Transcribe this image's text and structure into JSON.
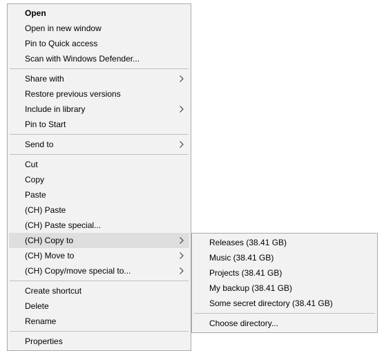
{
  "mainMenu": {
    "open": "Open",
    "openNew": "Open in new window",
    "pinQuick": "Pin to Quick access",
    "scanDefender": "Scan with Windows Defender...",
    "shareWith": "Share with",
    "restorePrev": "Restore previous versions",
    "includeLib": "Include in library",
    "pinStart": "Pin to Start",
    "sendTo": "Send to",
    "cut": "Cut",
    "copy": "Copy",
    "paste": "Paste",
    "chPaste": "(CH) Paste",
    "chPasteSpecial": "(CH) Paste special...",
    "chCopyTo": "(CH) Copy to",
    "chMoveTo": "(CH) Move to",
    "chCopyMoveSpecial": "(CH) Copy/move special to...",
    "createShortcut": "Create shortcut",
    "delete": "Delete",
    "rename": "Rename",
    "properties": "Properties"
  },
  "subMenu": {
    "releases": "Releases (38.41 GB)",
    "music": "Music (38.41 GB)",
    "projects": "Projects (38.41 GB)",
    "myBackup": "My backup (38.41 GB)",
    "secret": "Some secret directory (38.41 GB)",
    "choose": "Choose directory..."
  }
}
